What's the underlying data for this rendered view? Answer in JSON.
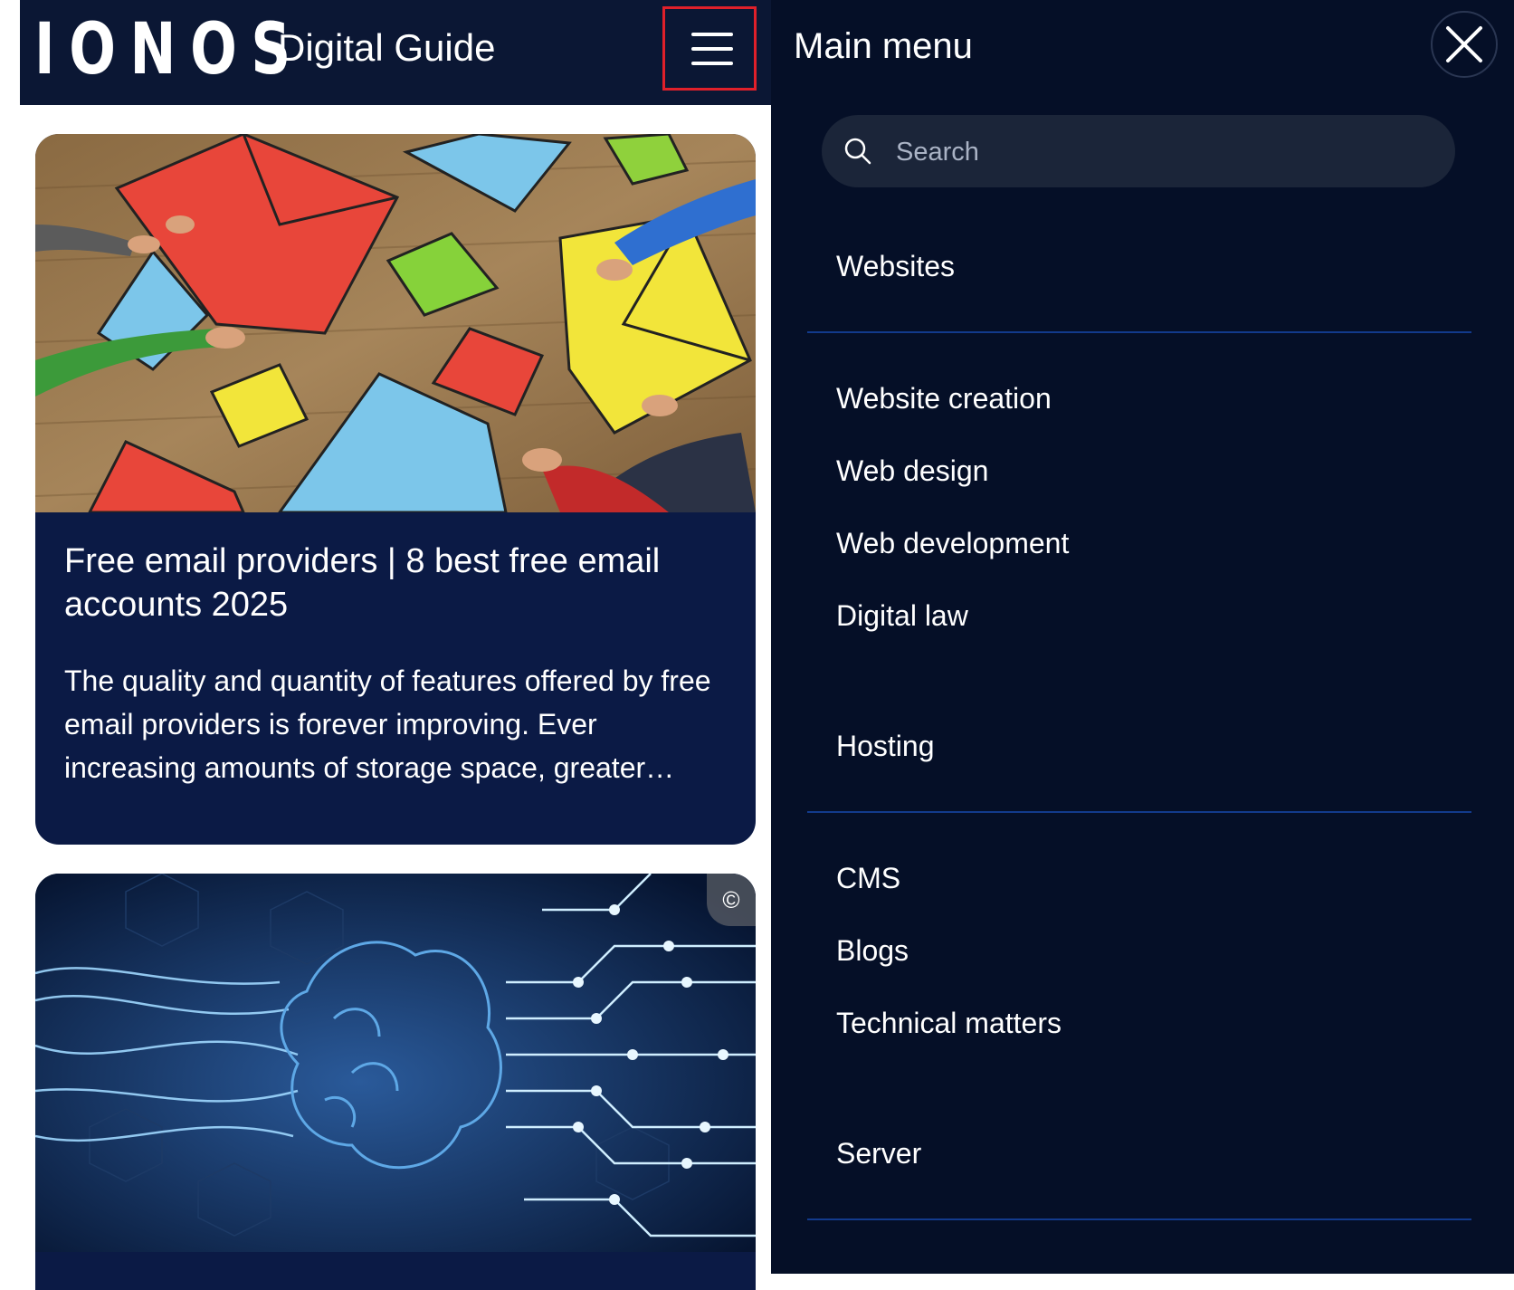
{
  "header": {
    "logo": "IONOS",
    "site_name": "Digital Guide",
    "menu_button_icon": "hamburger-icon"
  },
  "cards": [
    {
      "title": "Free email providers | 8 best free email accounts 2025",
      "teaser": "The quality and quantity of features offered by free email providers is forever improving. Ever increasing amounts of storage space, greater…",
      "image": "colorful-envelopes-photo"
    },
    {
      "image": "digital-brain-circuit-illustration",
      "copyright_symbol": "©"
    }
  ],
  "menu": {
    "title": "Main menu",
    "close_icon": "close-icon",
    "search": {
      "placeholder": "Search",
      "value": ""
    },
    "sections": [
      {
        "heading": "Websites",
        "items": [
          "Website creation",
          "Web design",
          "Web development",
          "Digital law"
        ]
      },
      {
        "heading": "Hosting",
        "items": [
          "CMS",
          "Blogs",
          "Technical matters"
        ]
      },
      {
        "heading": "Server",
        "items": []
      }
    ]
  },
  "colors": {
    "header_bg": "#0b1734",
    "card_bg": "#0b1a45",
    "menu_bg": "#050f27",
    "divider": "#123a8c",
    "highlight": "#e0202a"
  }
}
